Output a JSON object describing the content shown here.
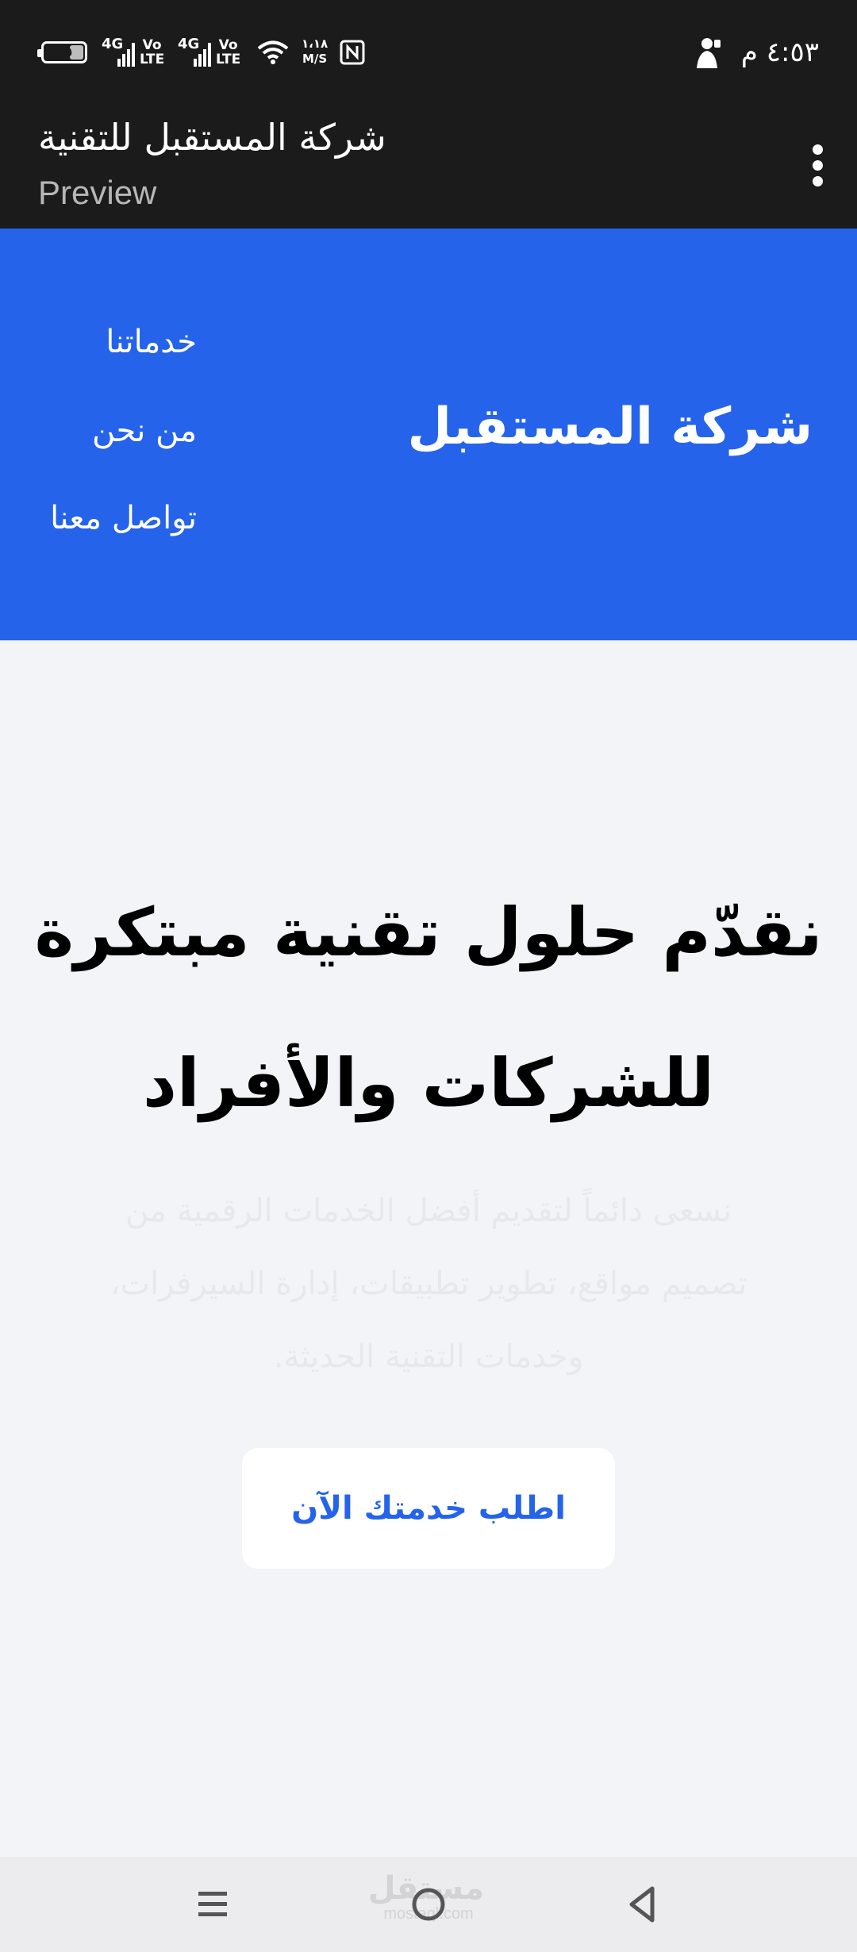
{
  "status_bar": {
    "time": "٤:٥٣ م",
    "battery_level": "٣٥",
    "battery_percent": 35,
    "sim1_network": "4G",
    "sim1_volte": [
      "Vo",
      "LTE"
    ],
    "sim2_network": "4G",
    "sim2_volte": [
      "Vo",
      "LTE"
    ],
    "speed_value": "١،١٨",
    "speed_unit": "M/S",
    "icons": [
      "battery-icon",
      "signal-icon",
      "wifi-icon",
      "nfc-icon",
      "person-icon"
    ]
  },
  "app_bar": {
    "title": "شركة المستقبل للتقنية",
    "subtitle": "Preview",
    "more_icon": "more-vert-icon"
  },
  "site_header": {
    "brand": "شركة المستقبل",
    "nav": [
      "خدماتنا",
      "من نحن",
      "تواصل معنا"
    ]
  },
  "hero": {
    "title_line1": "نقدّم حلول تقنية مبتكرة",
    "title_line2": "للشركات والأفراد",
    "text_line1": "نسعى دائماً لتقديم أفضل الخدمات الرقمية من",
    "text_line2": "تصميم مواقع، تطوير تطبيقات، إدارة السيرفرات،",
    "text_line3": "وخدمات التقنية الحديثة.",
    "cta": "اطلب خدمتك الآن"
  },
  "nav_bar": {
    "watermark_ar": "مستقل",
    "watermark_latin": "mostaql.com",
    "icons": [
      "menu-icon",
      "home-icon",
      "back-icon"
    ]
  },
  "colors": {
    "status_bar": "#1b1b1b",
    "header_blue": "#2563eb",
    "page_background": "#f3f4f8",
    "cta_text": "#2563eb",
    "subtitle_gray": "#b7b7b7"
  }
}
